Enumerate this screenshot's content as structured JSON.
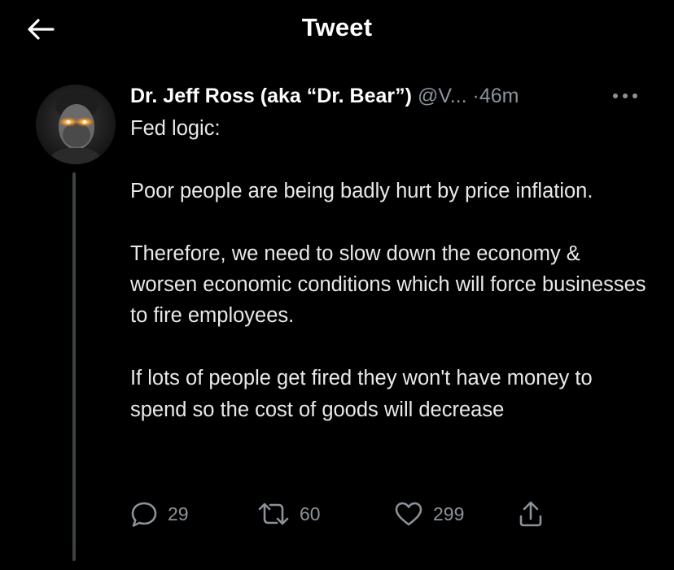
{
  "header": {
    "title": "Tweet",
    "back_icon": "arrow-left-icon"
  },
  "tweet": {
    "author": "Dr. Jeff Ross (aka “Dr. Bear”)",
    "handle": "@V...",
    "separator": "·",
    "time": "46m",
    "more_icon": "more-horizontal-icon",
    "paragraphs": [
      "Fed logic:",
      "Poor people are being badly hurt by price inflation.",
      "Therefore, we need to slow down the economy & worsen economic conditions which will force businesses to fire employees.",
      "If lots of people get fired they won't have money to spend so the cost of goods will decrease"
    ],
    "actions": {
      "reply_count": "29",
      "retweet_count": "60",
      "like_count": "299"
    }
  },
  "colors": {
    "background": "#000000",
    "text": "#e7e9ea",
    "secondary": "#8b9298",
    "thread_line": "#3e4144"
  }
}
